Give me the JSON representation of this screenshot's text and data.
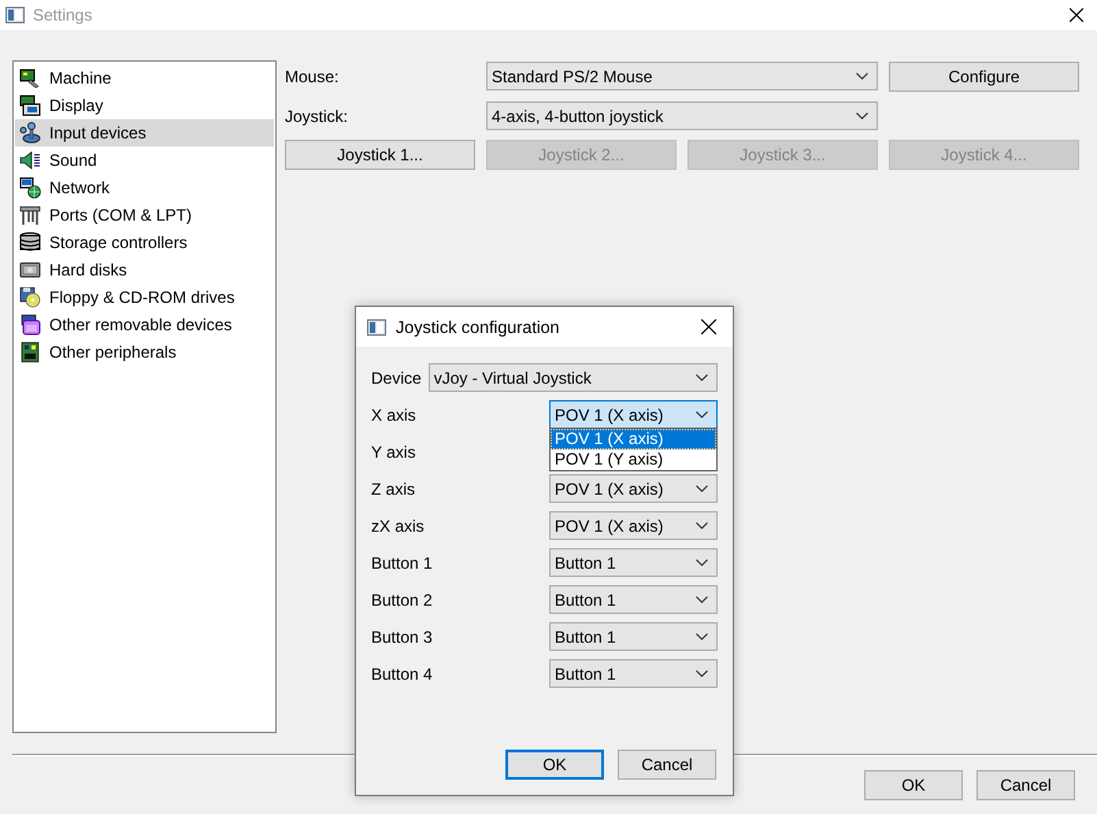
{
  "window": {
    "title": "Settings"
  },
  "sidebar": {
    "items": [
      {
        "label": "Machine",
        "kind": "machine",
        "selected": false
      },
      {
        "label": "Display",
        "kind": "display",
        "selected": false
      },
      {
        "label": "Input devices",
        "kind": "input",
        "selected": true
      },
      {
        "label": "Sound",
        "kind": "sound",
        "selected": false
      },
      {
        "label": "Network",
        "kind": "network",
        "selected": false
      },
      {
        "label": "Ports (COM & LPT)",
        "kind": "ports",
        "selected": false
      },
      {
        "label": "Storage controllers",
        "kind": "storage",
        "selected": false
      },
      {
        "label": "Hard disks",
        "kind": "hdd",
        "selected": false
      },
      {
        "label": "Floppy & CD-ROM drives",
        "kind": "floppy",
        "selected": false
      },
      {
        "label": "Other removable devices",
        "kind": "removable",
        "selected": false
      },
      {
        "label": "Other peripherals",
        "kind": "peripherals",
        "selected": false
      }
    ]
  },
  "input_devices": {
    "mouse": {
      "label": "Mouse:",
      "value": "Standard PS/2 Mouse"
    },
    "configure_button": {
      "label": "Configure",
      "disabled": false
    },
    "joystick": {
      "label": "Joystick:",
      "value": "4-axis, 4-button joystick"
    },
    "joystick_buttons": [
      {
        "label": "Joystick 1...",
        "disabled": false
      },
      {
        "label": "Joystick 2...",
        "disabled": true
      },
      {
        "label": "Joystick 3...",
        "disabled": true
      },
      {
        "label": "Joystick 4...",
        "disabled": true
      }
    ]
  },
  "buttons": [
    {
      "label": "OK"
    },
    {
      "label": "Cancel"
    }
  ],
  "dialog": {
    "title": "Joystick configuration",
    "device": {
      "label": "Device",
      "value": "vJoy - Virtual Joystick"
    },
    "mappings": [
      {
        "label": "X axis",
        "value": "POV 1 (X axis)",
        "options": [
          {
            "label": "POV 1 (X axis)",
            "selected": true
          },
          {
            "label": "POV 1 (Y axis)",
            "selected": false
          }
        ]
      },
      {
        "label": "Y axis"
      },
      {
        "label": "Z axis",
        "value": "POV 1 (X axis)"
      },
      {
        "label": "zX axis",
        "value": "POV 1 (X axis)"
      },
      {
        "label": "Button 1",
        "value": "Button 1"
      },
      {
        "label": "Button 2",
        "value": "Button 1"
      },
      {
        "label": "Button 3",
        "value": "Button 1"
      },
      {
        "label": "Button 4",
        "value": "Button 1"
      }
    ],
    "buttons": [
      {
        "label": "OK",
        "focused": true
      },
      {
        "label": "Cancel",
        "focused": false
      }
    ]
  }
}
